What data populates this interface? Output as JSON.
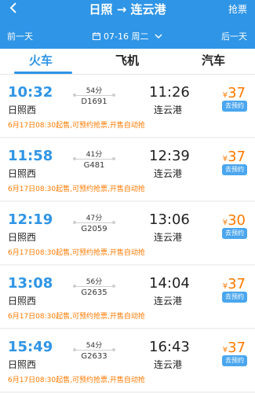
{
  "header": {
    "title": "日照 → 连云港",
    "grab_label": "抢票",
    "prev_day": "前一天",
    "next_day": "后一天",
    "date": "07-16 周二"
  },
  "tabs": [
    {
      "label": "火车",
      "active": true
    },
    {
      "label": "飞机",
      "active": false
    },
    {
      "label": "汽车",
      "active": false
    }
  ],
  "trains": [
    {
      "dep_time": "10:32",
      "dep_station": "日照西",
      "duration": "54分",
      "train_no": "D1691",
      "arr_time": "11:26",
      "arr_station": "连云港",
      "currency": "¥",
      "price": "37",
      "reserve_label": "去预约",
      "notice": "6月17日08:30起售,可预约抢票,开售自动抢"
    },
    {
      "dep_time": "11:58",
      "dep_station": "日照西",
      "duration": "41分",
      "train_no": "G481",
      "arr_time": "12:39",
      "arr_station": "连云港",
      "currency": "¥",
      "price": "37",
      "reserve_label": "去预约",
      "notice": "6月17日08:30起售,可预约抢票,开售自动抢"
    },
    {
      "dep_time": "12:19",
      "dep_station": "日照西",
      "duration": "47分",
      "train_no": "G2059",
      "arr_time": "13:06",
      "arr_station": "连云港",
      "currency": "¥",
      "price": "30",
      "reserve_label": "去预约",
      "notice": "6月17日08:30起售,可预约抢票,开售自动抢"
    },
    {
      "dep_time": "13:08",
      "dep_station": "日照西",
      "duration": "56分",
      "train_no": "G2635",
      "arr_time": "14:04",
      "arr_station": "连云港",
      "currency": "¥",
      "price": "37",
      "reserve_label": "去预约",
      "notice": "6月17日08:30起售,可预约抢票,开售自动抢"
    },
    {
      "dep_time": "15:49",
      "dep_station": "日照西",
      "duration": "54分",
      "train_no": "G2633",
      "arr_time": "16:43",
      "arr_station": "连云港",
      "currency": "¥",
      "price": "37",
      "reserve_label": "去预约",
      "notice": "6月17日08:30起售,可预约抢票,开售自动抢"
    }
  ],
  "colors": {
    "primary": "#2f95e6",
    "price": "#ff7a00",
    "reserve_bg": "#4aa6ee"
  },
  "icons": {
    "back": "back-arrow-icon",
    "calendar": "calendar-icon",
    "dropdown": "chevron-down-icon"
  }
}
